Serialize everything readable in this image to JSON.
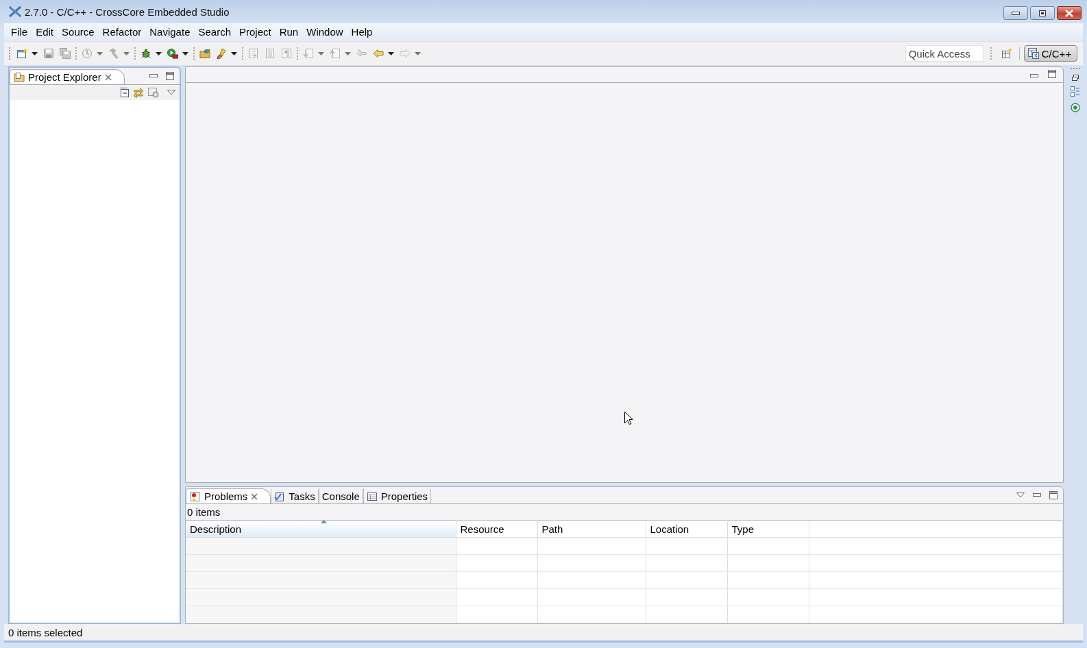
{
  "window": {
    "title": "2.7.0 - C/C++ - CrossCore Embedded Studio"
  },
  "menu": [
    "File",
    "Edit",
    "Source",
    "Refactor",
    "Navigate",
    "Search",
    "Project",
    "Run",
    "Window",
    "Help"
  ],
  "toolbar": [
    {
      "kind": "new",
      "disabled": false,
      "dropdown": true
    },
    {
      "kind": "save",
      "disabled": true,
      "dropdown": false
    },
    {
      "kind": "save-all",
      "disabled": true,
      "dropdown": false
    },
    {
      "kind": "separator"
    },
    {
      "kind": "build-config",
      "disabled": true,
      "dropdown": true
    },
    {
      "kind": "build",
      "disabled": true,
      "dropdown": true
    },
    {
      "kind": "separator"
    },
    {
      "kind": "debug",
      "disabled": false,
      "dropdown": true
    },
    {
      "kind": "run",
      "disabled": false,
      "dropdown": true
    },
    {
      "kind": "separator"
    },
    {
      "kind": "open",
      "disabled": false,
      "dropdown": false
    },
    {
      "kind": "brush",
      "disabled": false,
      "dropdown": true
    },
    {
      "kind": "separator"
    },
    {
      "kind": "toggle-block",
      "disabled": true,
      "dropdown": false
    },
    {
      "kind": "toggle-mark",
      "disabled": true,
      "dropdown": false
    },
    {
      "kind": "whitespace",
      "disabled": true,
      "dropdown": false
    },
    {
      "kind": "separator"
    },
    {
      "kind": "next-annotation",
      "disabled": true,
      "dropdown": true
    },
    {
      "kind": "prev-annotation",
      "disabled": true,
      "dropdown": true
    },
    {
      "kind": "last-edit",
      "disabled": true,
      "dropdown": false
    },
    {
      "kind": "back",
      "disabled": false,
      "dropdown": true
    },
    {
      "kind": "forward",
      "disabled": true,
      "dropdown": true
    }
  ],
  "quick_access": {
    "placeholder": "Quick Access"
  },
  "perspectives": [
    {
      "label": "C/C++",
      "selected": true
    }
  ],
  "project_explorer": {
    "tabs": [
      {
        "label": "Project Explorer",
        "selected": true,
        "closable": true
      }
    ]
  },
  "bottom_panel": {
    "tabs": [
      {
        "label": "Problems",
        "selected": true,
        "closable": true
      },
      {
        "label": "Tasks",
        "selected": false,
        "closable": false
      },
      {
        "label": "Console",
        "selected": false,
        "closable": false
      },
      {
        "label": "Properties",
        "selected": false,
        "closable": false
      }
    ],
    "summary": "0 items",
    "columns": [
      {
        "label": "Description",
        "sorted": true
      },
      {
        "label": "Resource",
        "sorted": false
      },
      {
        "label": "Path",
        "sorted": false
      },
      {
        "label": "Location",
        "sorted": false
      },
      {
        "label": "Type",
        "sorted": false
      }
    ]
  },
  "status_bar": {
    "text": "0 items selected"
  }
}
